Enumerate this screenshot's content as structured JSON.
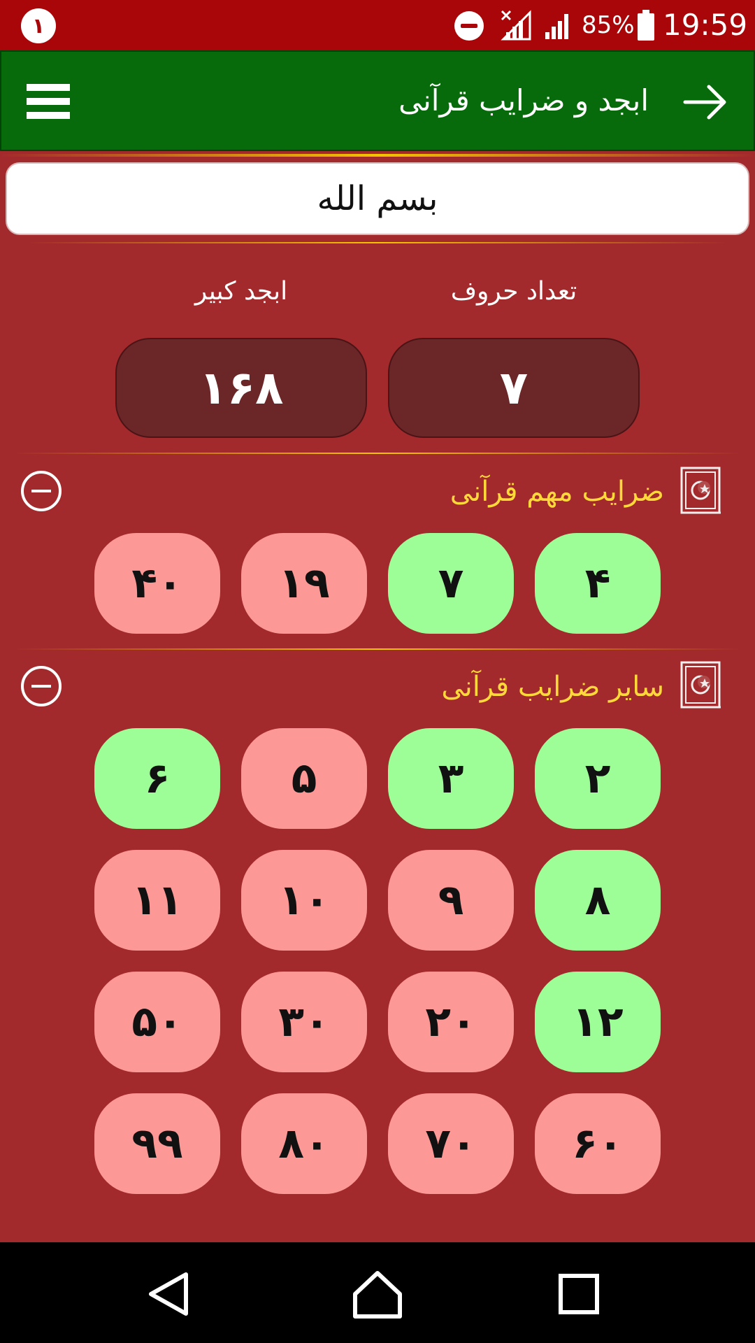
{
  "status_bar": {
    "notification_count": "١",
    "battery": "85%",
    "time": "19:59",
    "icons": [
      "do-not-disturb-icon",
      "signal-no-data-icon",
      "signal-icon",
      "battery-icon"
    ]
  },
  "app_bar": {
    "title": "ابجد و ضرایب قرآنی",
    "back_icon": "arrow-right-icon",
    "menu_icon": "hamburger-menu-icon",
    "color": "#076b0b"
  },
  "input": {
    "value": "بسم الله"
  },
  "results": {
    "letter_count_label": "تعداد حروف",
    "letter_count_value": "٧",
    "abjad_label": "ابجد کبیر",
    "abjad_value": "١۶٨"
  },
  "sections": [
    {
      "title": "ضرایب مهم قرآنی",
      "icon": "quran-book-icon",
      "collapse_icon": "minus-circle-icon",
      "items": [
        {
          "label": "۴",
          "state": "green"
        },
        {
          "label": "٧",
          "state": "green"
        },
        {
          "label": "١٩",
          "state": "red"
        },
        {
          "label": "۴٠",
          "state": "red"
        }
      ]
    },
    {
      "title": "سایر ضرایب قرآنی",
      "icon": "quran-book-icon",
      "collapse_icon": "minus-circle-icon",
      "items": [
        {
          "label": "٢",
          "state": "green"
        },
        {
          "label": "٣",
          "state": "green"
        },
        {
          "label": "۵",
          "state": "red"
        },
        {
          "label": "۶",
          "state": "green"
        },
        {
          "label": "٨",
          "state": "green"
        },
        {
          "label": "٩",
          "state": "red"
        },
        {
          "label": "١٠",
          "state": "red"
        },
        {
          "label": "١١",
          "state": "red"
        },
        {
          "label": "١٢",
          "state": "green"
        },
        {
          "label": "٢٠",
          "state": "red"
        },
        {
          "label": "٣٠",
          "state": "red"
        },
        {
          "label": "۵٠",
          "state": "red"
        },
        {
          "label": "۶٠",
          "state": "red"
        },
        {
          "label": "٧٠",
          "state": "red"
        },
        {
          "label": "٨٠",
          "state": "red"
        },
        {
          "label": "٩٩",
          "state": "red"
        }
      ]
    }
  ],
  "colors": {
    "green_pill": "#9dfd97",
    "red_pill": "#fc9896",
    "section_title": "#ffd83a",
    "background": "#a32a2c"
  },
  "nav_bar": {
    "icons": [
      "back-triangle-icon",
      "home-icon",
      "recents-square-icon"
    ]
  }
}
